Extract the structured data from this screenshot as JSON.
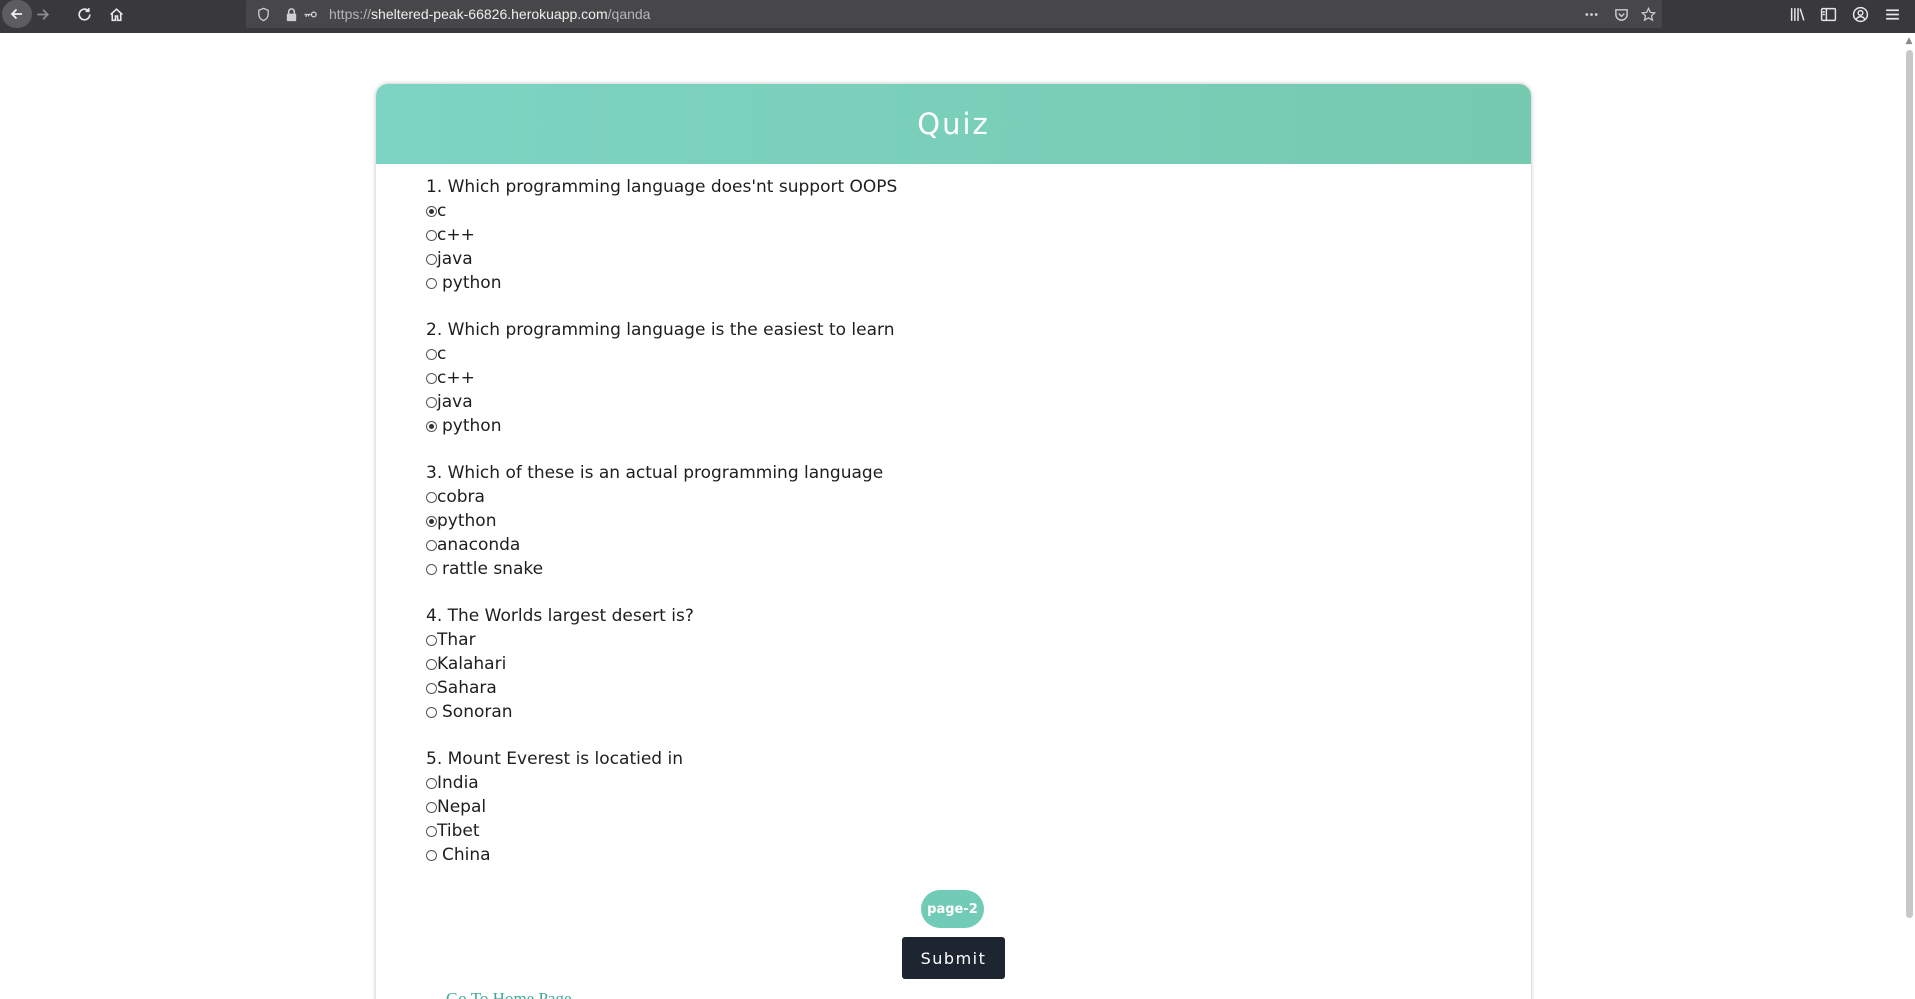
{
  "browser": {
    "url_prefix": "https://",
    "url_host": "sheltered-peak-66826.herokuapp.com",
    "url_path": "/qanda",
    "icons": [
      "back-icon",
      "forward-icon",
      "reload-icon",
      "home-icon",
      "shield-icon",
      "lock-icon",
      "key-icon",
      "more-icon",
      "pocket-icon",
      "star-icon",
      "library-icon",
      "sidebar-icon",
      "account-icon",
      "menu-icon"
    ]
  },
  "quiz": {
    "title": "Quiz",
    "questions": [
      {
        "text": "1. Which programming language does'nt support OOPS",
        "options": [
          {
            "label": "c",
            "checked": true
          },
          {
            "label": "c++",
            "checked": false
          },
          {
            "label": "java",
            "checked": false
          },
          {
            "label": "python",
            "checked": false
          }
        ]
      },
      {
        "text": "2. Which programming language is the easiest to learn",
        "options": [
          {
            "label": "c",
            "checked": false
          },
          {
            "label": "c++",
            "checked": false
          },
          {
            "label": "java",
            "checked": false
          },
          {
            "label": "python",
            "checked": true
          }
        ]
      },
      {
        "text": "3. Which of these is an actual programming language",
        "options": [
          {
            "label": "cobra",
            "checked": false
          },
          {
            "label": "python",
            "checked": true
          },
          {
            "label": "anaconda",
            "checked": false
          },
          {
            "label": "rattle snake",
            "checked": false
          }
        ]
      },
      {
        "text": "4. The Worlds largest desert is?",
        "options": [
          {
            "label": "Thar",
            "checked": false
          },
          {
            "label": "Kalahari",
            "checked": false
          },
          {
            "label": "Sahara",
            "checked": false
          },
          {
            "label": "Sonoran",
            "checked": false
          }
        ]
      },
      {
        "text": "5. Mount Everest is locatied in",
        "options": [
          {
            "label": "India",
            "checked": false
          },
          {
            "label": "Nepal",
            "checked": false
          },
          {
            "label": "Tibet",
            "checked": false
          },
          {
            "label": "China",
            "checked": false
          }
        ]
      }
    ],
    "page_label": "page-2",
    "submit_label": "Submit",
    "home_link": "Go To Home Page"
  },
  "colors": {
    "header_start": "#7dd4c3",
    "header_end": "#75caaf",
    "pill": "#72cbb6",
    "submit_bg": "#1d2530",
    "link": "#3fa89b"
  }
}
